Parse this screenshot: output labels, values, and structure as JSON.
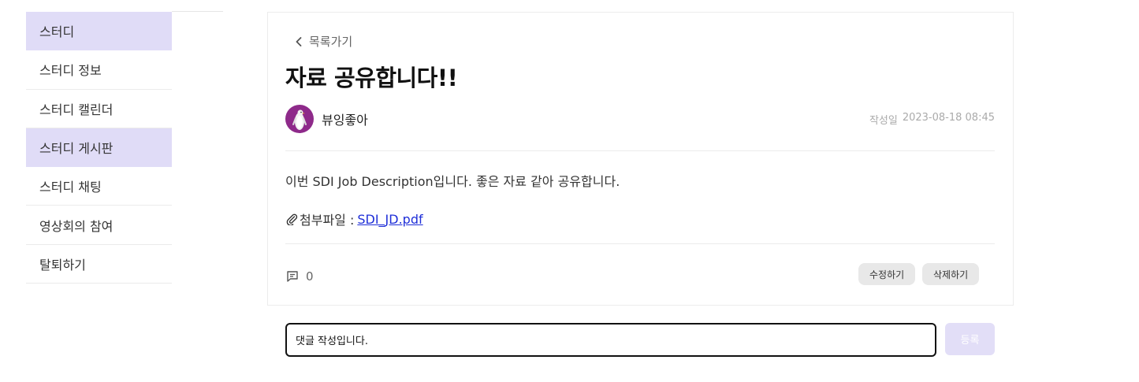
{
  "sidebar": {
    "items": [
      {
        "label": "스터디",
        "active": true
      },
      {
        "label": "스터디 정보",
        "active": false
      },
      {
        "label": "스터디 캘린더",
        "active": false
      },
      {
        "label": "스터디 게시판",
        "active": true
      },
      {
        "label": "스터디 채팅",
        "active": false
      },
      {
        "label": "영상회의 참여",
        "active": false
      },
      {
        "label": "탈퇴하기",
        "active": false
      }
    ]
  },
  "post": {
    "back_label": "목록가기",
    "title": "자료 공유합니다!!",
    "author": "뷰잉좋아",
    "date_label": "작성일",
    "date": "2023-08-18 08:45",
    "content": "이번 SDI Job  Description입니다. 좋은 자료 같아 공유합니다.",
    "attachment_label": "첨부파일 :",
    "attachment_file": "SDI_JD.pdf",
    "comment_count": "0",
    "edit_label": "수정하기",
    "delete_label": "삭제하기"
  },
  "comment_form": {
    "value": "댓글 작성입니다.",
    "submit_label": "등록"
  },
  "colors": {
    "accent": "#e0dcf7",
    "link": "#1f2fd8",
    "avatar_bg": "#8e2a8a"
  }
}
